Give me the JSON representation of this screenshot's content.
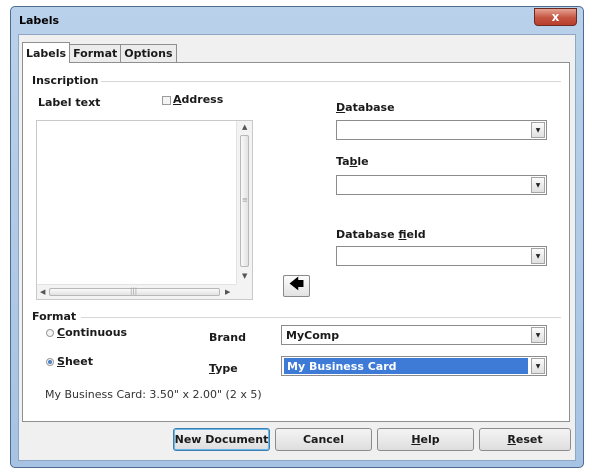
{
  "window": {
    "title": "Labels",
    "close_glyph": "x"
  },
  "tabs": [
    {
      "label": "Labels",
      "active": true
    },
    {
      "label": "Format",
      "active": false
    },
    {
      "label": "Options",
      "active": false
    }
  ],
  "inscription": {
    "group_title": "Inscription",
    "label_text_label": "Label text",
    "address_checkbox_label": "Address",
    "address_checked": false,
    "label_text_value": "",
    "insert_arrow_glyph": "🡄",
    "database": {
      "label": "Database",
      "value": ""
    },
    "table": {
      "label": "Table",
      "value": ""
    },
    "database_field": {
      "label": "Database field",
      "value": ""
    }
  },
  "format": {
    "group_title": "Format",
    "continuous_label": "Continuous",
    "sheet_label": "Sheet",
    "selected": "Sheet",
    "brand": {
      "label": "Brand",
      "value": "MyComp"
    },
    "type": {
      "label": "Type",
      "value": "My Business Card"
    },
    "description": "My Business Card: 3.50\" x 2.00\" (2 x 5)"
  },
  "buttons": {
    "new_document": "New Document",
    "cancel": "Cancel",
    "help": "Help",
    "reset": "Reset"
  },
  "colors": {
    "selection": "#3d7bd6",
    "title_bar": "#b9d1ea",
    "close_button": "#c45340"
  }
}
